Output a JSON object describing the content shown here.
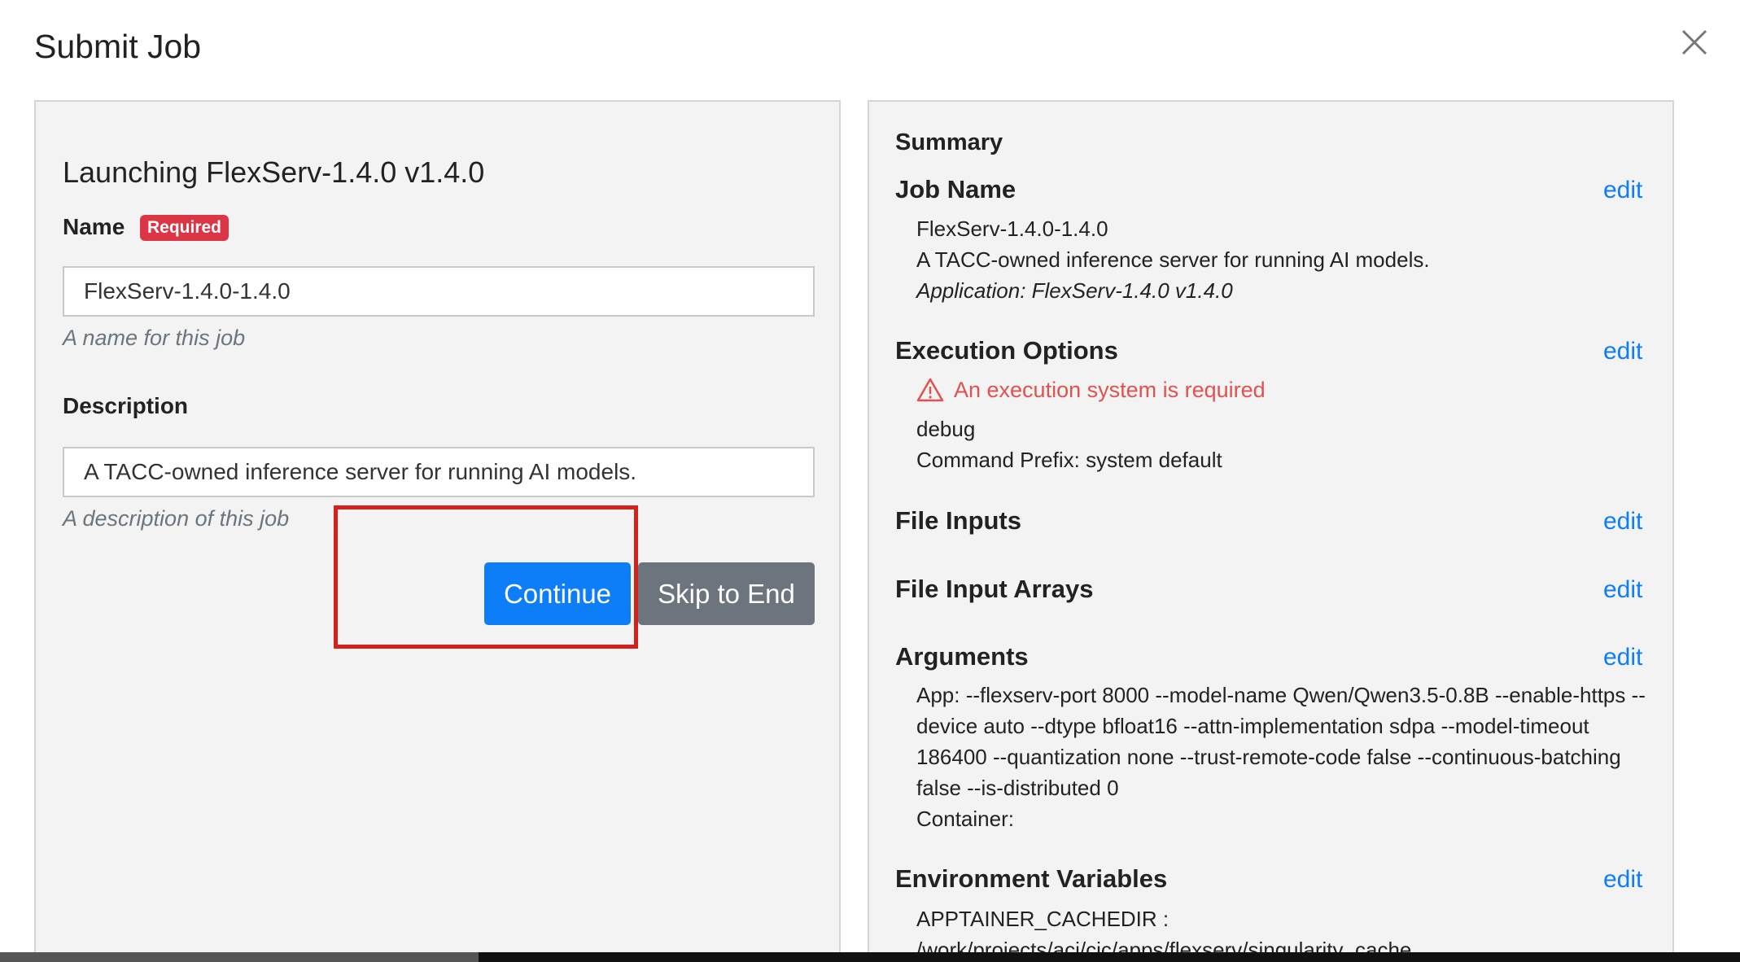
{
  "modal": {
    "title": "Submit Job",
    "close_icon": "close-icon"
  },
  "form": {
    "launch_title": "Launching FlexServ-1.4.0 v1.4.0",
    "name_label": "Name",
    "required_badge": "Required",
    "name_value": "FlexServ-1.4.0-1.4.0",
    "name_help": "A name for this job",
    "description_label": "Description",
    "description_value": "A TACC-owned inference server for running AI models.",
    "description_help": "A description of this job",
    "continue_label": "Continue",
    "skip_label": "Skip to End"
  },
  "summary": {
    "heading": "Summary",
    "edit_label": "edit",
    "job_name": {
      "title": "Job Name",
      "name": "FlexServ-1.4.0-1.4.0",
      "description": "A TACC-owned inference server for running AI models.",
      "application": "Application: FlexServ-1.4.0 v1.4.0"
    },
    "execution_options": {
      "title": "Execution Options",
      "error": "An execution system is required",
      "error_icon": "warning-icon",
      "queue": "debug",
      "command_prefix": "Command Prefix: system default"
    },
    "file_inputs": {
      "title": "File Inputs"
    },
    "file_input_arrays": {
      "title": "File Input Arrays"
    },
    "arguments": {
      "title": "Arguments",
      "app_args": "App: --flexserv-port 8000 --model-name Qwen/Qwen3.5-0.8B --enable-https --device auto --dtype bfloat16 --attn-implementation sdpa --model-timeout 186400 --quantization none --trust-remote-code false --continuous-batching false --is-distributed 0",
      "container": "Container:"
    },
    "environment_variables": {
      "title": "Environment Variables",
      "var_name": "APPTAINER_CACHEDIR :",
      "var_value": "/work/projects/aci/cic/apps/flexserv/singularity_cache"
    }
  },
  "colors": {
    "primary": "#0d7ef8",
    "secondary": "#6c757d",
    "danger": "#dc3545",
    "error_text": "#e0524f",
    "highlight": "#d4211b"
  }
}
